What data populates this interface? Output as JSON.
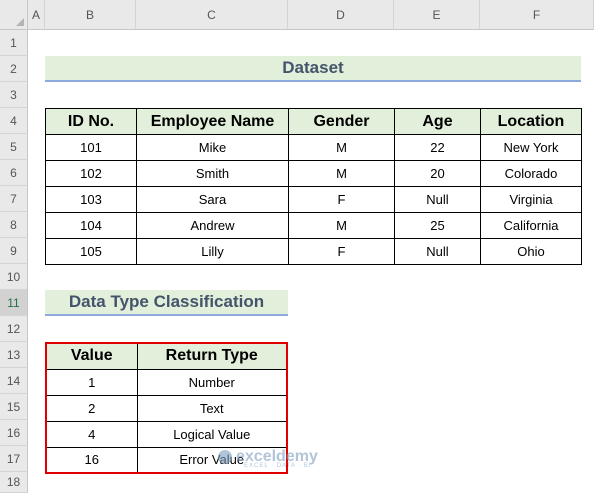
{
  "columns": [
    "A",
    "B",
    "C",
    "D",
    "E",
    "F"
  ],
  "rows": [
    "1",
    "2",
    "3",
    "4",
    "5",
    "6",
    "7",
    "8",
    "9",
    "10",
    "11",
    "12",
    "13",
    "14",
    "15",
    "16",
    "17",
    "18"
  ],
  "dataset_title": "Dataset",
  "dataset": {
    "headers": [
      "ID No.",
      "Employee Name",
      "Gender",
      "Age",
      "Location"
    ],
    "rows": [
      [
        "101",
        "Mike",
        "M",
        "22",
        "New York"
      ],
      [
        "102",
        "Smith",
        "M",
        "20",
        "Colorado"
      ],
      [
        "103",
        "Sara",
        "F",
        "Null",
        "Virginia"
      ],
      [
        "104",
        "Andrew",
        "M",
        "25",
        "California"
      ],
      [
        "105",
        "Lilly",
        "F",
        "Null",
        "Ohio"
      ]
    ]
  },
  "classification_title": "Data Type Classification",
  "classification": {
    "headers": [
      "Value",
      "Return Type"
    ],
    "rows": [
      [
        "1",
        "Number"
      ],
      [
        "2",
        "Text"
      ],
      [
        "4",
        "Logical Value"
      ],
      [
        "16",
        "Error Value"
      ]
    ]
  },
  "watermark": {
    "name": "exceldemy",
    "tagline": "EXCEL · DATA · BI"
  }
}
